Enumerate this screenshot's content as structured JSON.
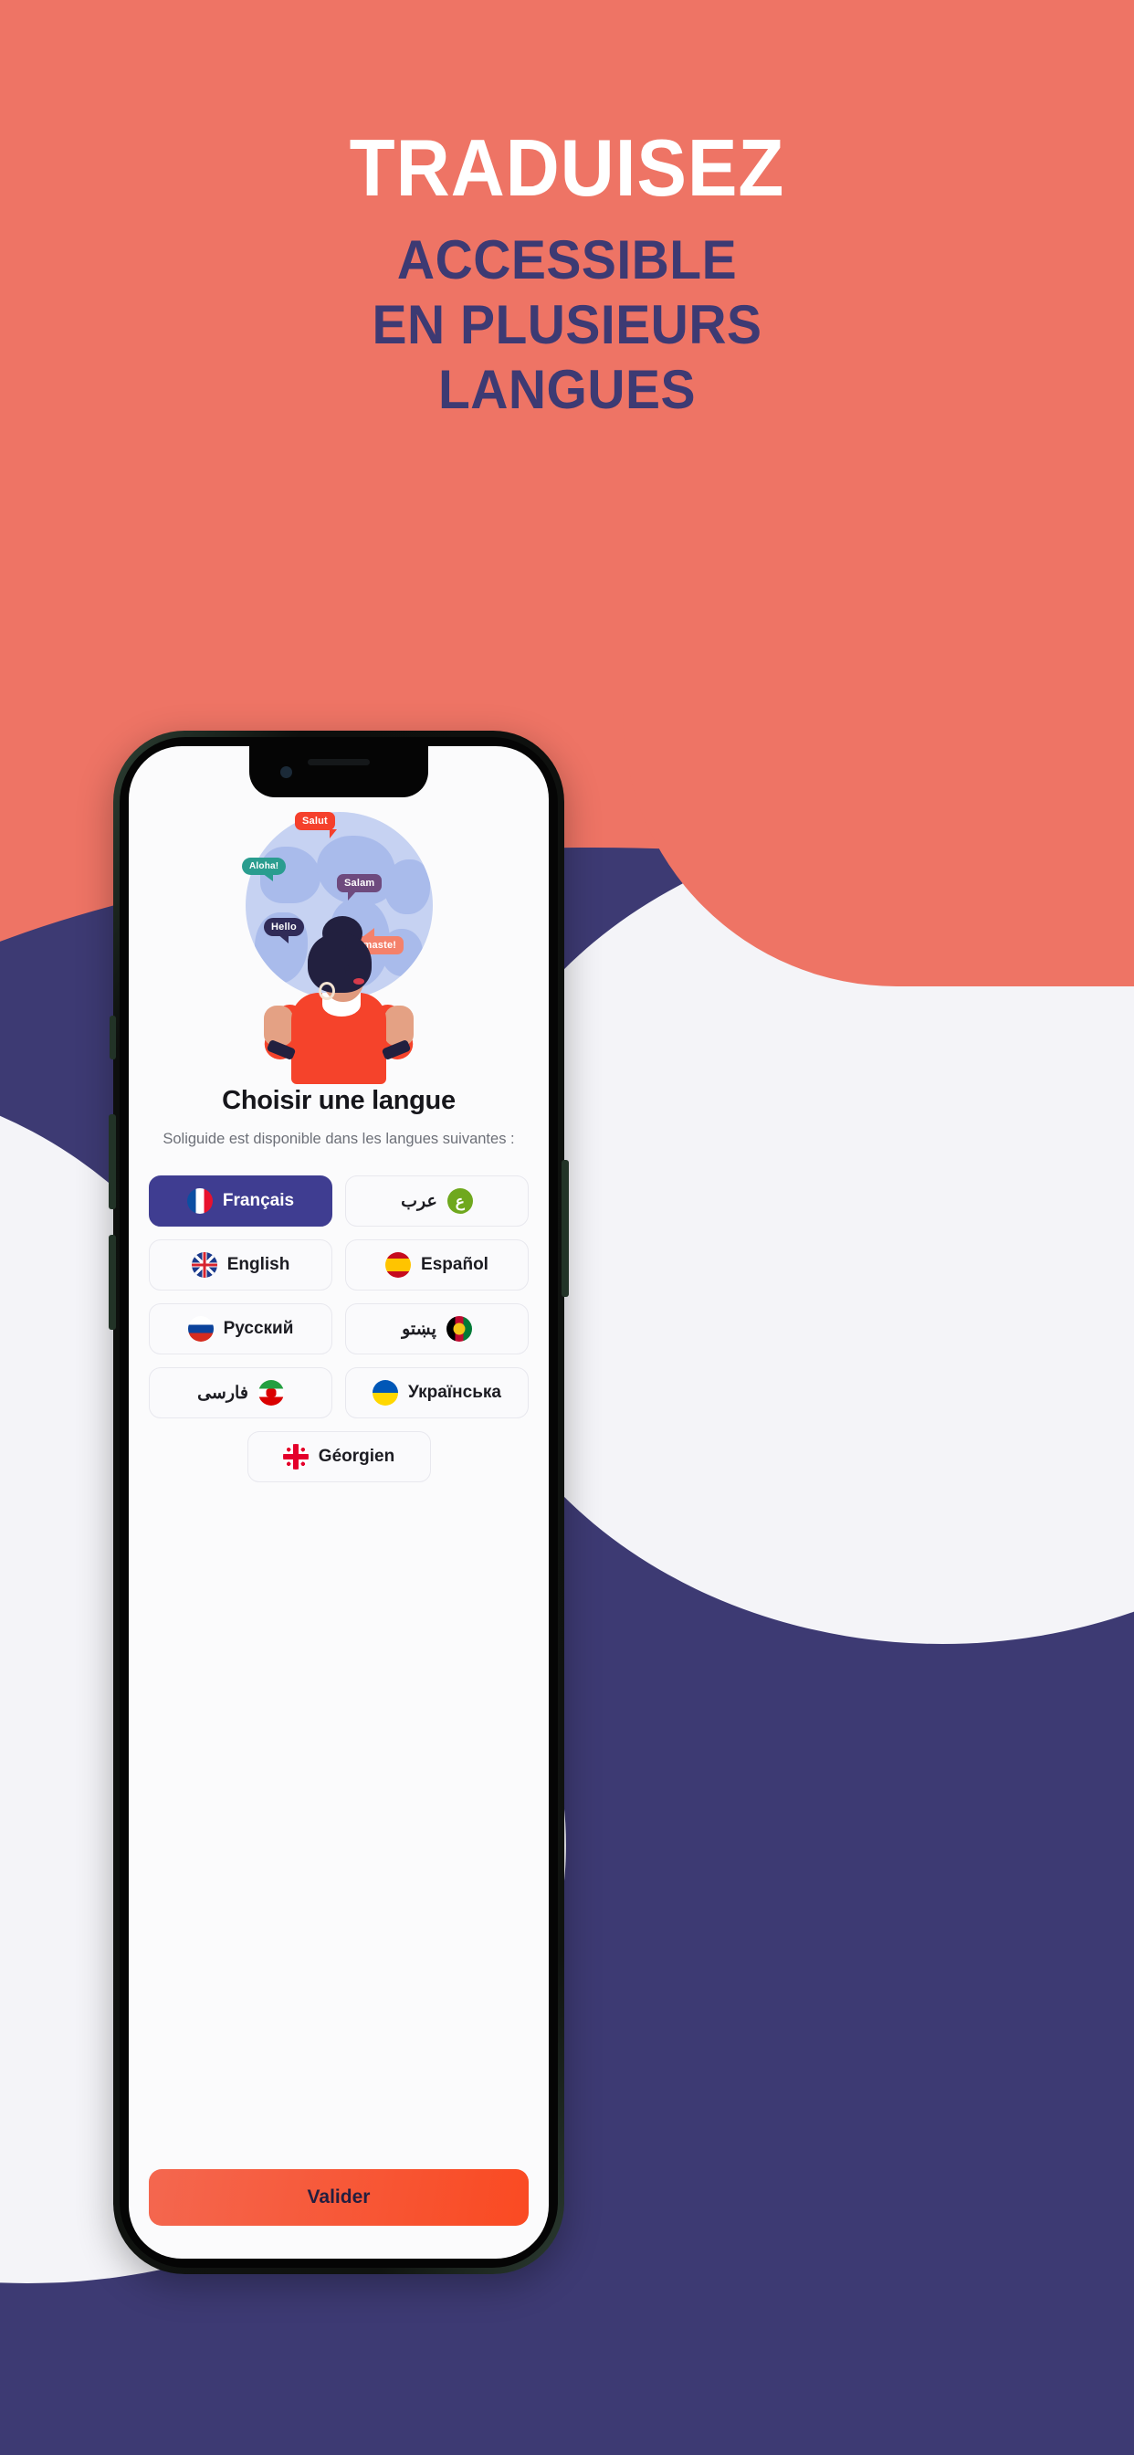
{
  "header": {
    "headline": "TRADUISEZ",
    "subhead_lines": [
      "ACCESSIBLE",
      "EN PLUSIEURS",
      "LANGUES"
    ]
  },
  "colors": {
    "background_coral": "#EE7465",
    "navy": "#3D3A73",
    "off_white": "#F4F4F8",
    "accent_orange": "#FA4A22",
    "selected_button": "#3F3D91"
  },
  "phone": {
    "app": {
      "illustration": {
        "name": "globe-with-speech-bubbles-and-woman",
        "bubbles": [
          {
            "text": "Salut",
            "color": "#F5402C"
          },
          {
            "text": "Aloha!",
            "color": "#2A9D8F"
          },
          {
            "text": "Salam",
            "color": "#6E4A7E"
          },
          {
            "text": "Hello",
            "color": "#302B58"
          },
          {
            "text": "Namaste!",
            "color": "#F4816B"
          }
        ]
      },
      "title": "Choisir une langue",
      "subtitle": "Soliguide est disponible dans les langues suivantes :",
      "languages": [
        {
          "label": "Français",
          "flag": "flag-fr",
          "selected": true,
          "rtl": false
        },
        {
          "label": "عرب",
          "flag": "flag-ar",
          "selected": false,
          "rtl": true,
          "glyph": "ع"
        },
        {
          "label": "English",
          "flag": "flag-gb",
          "selected": false,
          "rtl": false
        },
        {
          "label": "Español",
          "flag": "flag-es",
          "selected": false,
          "rtl": false
        },
        {
          "label": "Русский",
          "flag": "flag-ru",
          "selected": false,
          "rtl": false
        },
        {
          "label": "پښتو",
          "flag": "flag-af",
          "selected": false,
          "rtl": true
        },
        {
          "label": "فارسی",
          "flag": "flag-ir",
          "selected": false,
          "rtl": true
        },
        {
          "label": "Українська",
          "flag": "flag-ua",
          "selected": false,
          "rtl": false
        },
        {
          "label": "Géorgien",
          "flag": "flag-ge",
          "selected": false,
          "rtl": false
        }
      ],
      "validate_label": "Valider"
    }
  }
}
